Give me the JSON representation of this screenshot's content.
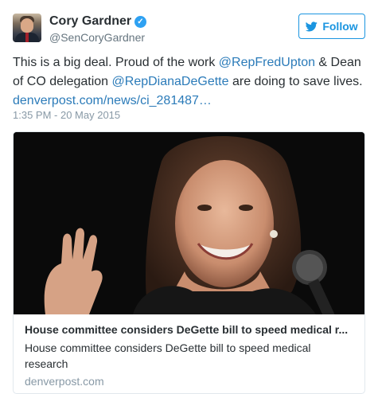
{
  "author": {
    "name": "Cory Gardner",
    "handle": "@SenCoryGardner",
    "verified_mark": "✓"
  },
  "follow_button": {
    "label": "Follow",
    "icon": "twitter-bird-icon"
  },
  "tweet": {
    "text_part1": "This is a big deal. Proud of the work ",
    "mention1": "@RepFredUpton",
    "text_part2": " & Dean of CO delegation ",
    "mention2": "@RepDianaDeGette",
    "text_part3": " are doing to save lives. ",
    "link": "denverpost.com/news/ci_281487…",
    "timestamp": "1:35 PM - 20 May 2015"
  },
  "card": {
    "image": "photo of woman speaking at a microphone",
    "title": "House committee considers DeGette bill to speed medical r...",
    "description": "House committee considers DeGette bill to speed medical research",
    "domain": "denverpost.com"
  },
  "colors": {
    "link": "#2b7bb9",
    "follow": "#1b95e0",
    "verified": "#2ea1f2",
    "muted": "#8899a6"
  }
}
